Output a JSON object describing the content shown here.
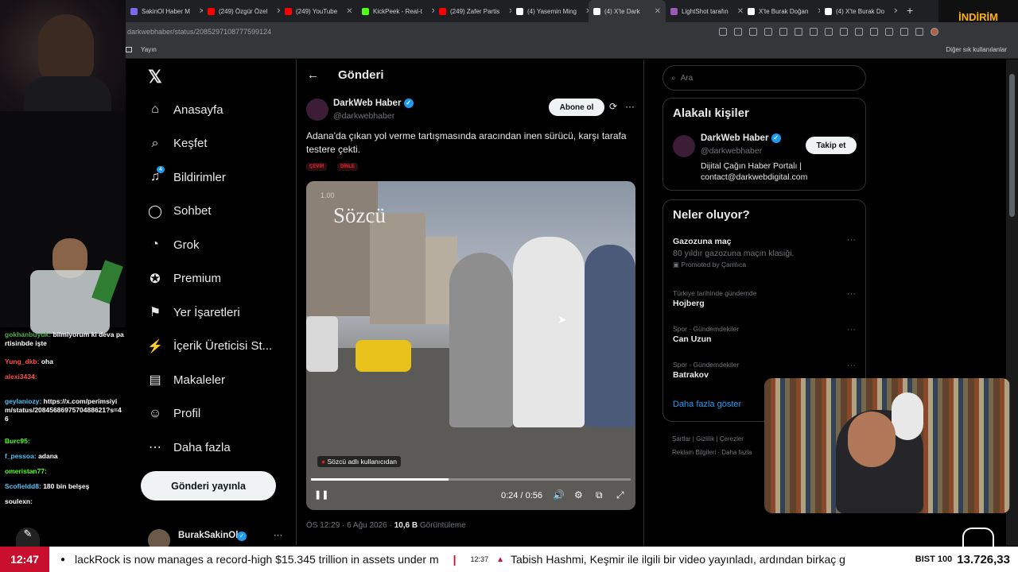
{
  "tabs": [
    {
      "label": "SakinOl Haber M",
      "color": "#7b68ee"
    },
    {
      "label": "(249) Özgür Özel",
      "color": "#ff0000"
    },
    {
      "label": "(249) YouTube",
      "color": "#ff0000"
    },
    {
      "label": "KickPeek - Real-t",
      "color": "#53fc18"
    },
    {
      "label": "(249) Zafer Partis",
      "color": "#ff0000"
    },
    {
      "label": "(4) Yasemin Ming",
      "color": "#ffffff"
    },
    {
      "label": "(4) X'te Dark",
      "color": "#ffffff"
    },
    {
      "label": "LightShot tarafın",
      "color": "#9b59b6"
    },
    {
      "label": "X'te Burak Doğan",
      "color": "#ffffff"
    },
    {
      "label": "(4) X'te Burak Do",
      "color": "#ffffff"
    }
  ],
  "address": "darkwebhaber/status/2085297108777599124",
  "bookmarks": {
    "first": "Yayın",
    "other": "Diğer sık kullanılanlar"
  },
  "promo": "İNDİRİM KODU",
  "nav": {
    "items": [
      {
        "label": "Anasayfa",
        "icon": "home-icon"
      },
      {
        "label": "Keşfet",
        "icon": "search-icon"
      },
      {
        "label": "Bildirimler",
        "icon": "bell-icon"
      },
      {
        "label": "Sohbet",
        "icon": "chat-icon"
      },
      {
        "label": "Grok",
        "icon": "grok-icon"
      },
      {
        "label": "Premium",
        "icon": "premium-icon"
      },
      {
        "label": "Yer İşaretleri",
        "icon": "bookmark-icon"
      },
      {
        "label": "İçerik Üreticisi St...",
        "icon": "creator-icon"
      },
      {
        "label": "Makaleler",
        "icon": "article-icon"
      },
      {
        "label": "Profil",
        "icon": "profile-icon"
      },
      {
        "label": "Daha fazla",
        "icon": "more-icon"
      }
    ],
    "notif_count": "4",
    "post_button": "Gönderi yayınla",
    "account_name": "BurakSakinOl"
  },
  "post": {
    "header": "Gönderi",
    "author_name": "DarkWeb Haber",
    "author_handle": "@darkwebhaber",
    "subscribe": "Abone ol",
    "text": "Adana'da çıkan yol verme tartışmasında aracından inen sürücü, karşı tarafa testere çekti.",
    "translate": "ÇEVİR",
    "listen": "DİNLE",
    "video_watermark": "Sözcü",
    "video_speed": "1.00",
    "video_source": "Sözcü adlı kullanıcıdan",
    "video_time": "0:24 / 0:56",
    "video_progress": 0.43,
    "meta_time": "ÖS 12:29 · 6 Ağu 2026 ·",
    "views": "10,6 B",
    "views_label": "Görüntüleme"
  },
  "sidebar": {
    "search_placeholder": "Ara",
    "related_title": "Alakalı kişiler",
    "related": {
      "name": "DarkWeb Haber",
      "handle": "@darkwebhaber",
      "bio": "Dijital Çağın Haber Portalı | contact@darkwebdigital.com",
      "follow": "Takip et"
    },
    "trends_title": "Neler oluyor?",
    "trends": [
      {
        "context": "",
        "title": "Gazozuna maç",
        "sub": "80 yıldır gazozuna maçın klasiği.",
        "promoted": "Promoted by Çamlıca"
      },
      {
        "context": "Türkiye tarihinde gündemde",
        "title": "Hojberg"
      },
      {
        "context": "Spor · Gündemdekiler",
        "title": "Can Uzun"
      },
      {
        "context": "Spor · Gündemdekiler",
        "title": "Batrakov"
      }
    ],
    "show_more": "Daha fazla göster",
    "footer1": [
      "Şartlar",
      "Gizlilik",
      "Çerezler"
    ],
    "footer2": [
      "Reklam Bilgileri",
      "Daha fazla"
    ]
  },
  "chat": [
    {
      "user": "gokhanbuyuk:",
      "msg": "bilmiyorum ki deva partisinbde işte",
      "color": "#4caf50"
    },
    {
      "user": "Yung_dkb:",
      "msg": "oha",
      "color": "#ff4d4d"
    },
    {
      "user": "alexi3434:",
      "msg": "",
      "color": "#ff4d4d"
    },
    {
      "user": "geylaniozy:",
      "msg": "https://x.com/perimsiyim/status/2084568697570488621?s=46",
      "color": "#4fc3f7"
    },
    {
      "user": "Burc95:",
      "msg": "",
      "color": "#53fc18"
    },
    {
      "user": "f_pessoa:",
      "msg": "adana",
      "color": "#4fc3f7"
    },
    {
      "user": "omeristan77:",
      "msg": "",
      "color": "#53fc18"
    },
    {
      "user": "Scofieldd8:",
      "msg": "180 bin belşeş",
      "color": "#4fc3f7"
    },
    {
      "user": "soulexn:",
      "msg": "",
      "color": "#ffffff"
    }
  ],
  "ticker": {
    "time": "12:47",
    "headline1": "lackRock is now manages a record-high $15.345 trillion in assets under m",
    "time2": "12:37",
    "headline2": "Tabish Hashmi, Keşmir ile ilgili bir video yayınladı, ardından birkaç g",
    "index_name": "BIST 100",
    "index_value": "13.726,33"
  }
}
